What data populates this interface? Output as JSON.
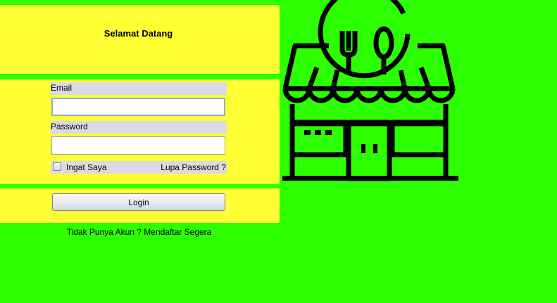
{
  "header": {
    "title": "Selamat Datang"
  },
  "form": {
    "email_label": "Email",
    "email_value": "",
    "password_label": "Password",
    "password_value": "",
    "remember_label": "Ingat Saya",
    "remember_checked": false,
    "forgot_link": "Lupa Password ?"
  },
  "actions": {
    "login_label": "Login"
  },
  "footer": {
    "signup_link": "Tidak Punya Akun ? Mendaftar Segera"
  },
  "illustration": {
    "icon": "restaurant-store-icon",
    "color": "#000000"
  },
  "colors": {
    "background": "#2bff00",
    "panel": "#ffff33",
    "field_label_bg": "#d8dbe3"
  }
}
